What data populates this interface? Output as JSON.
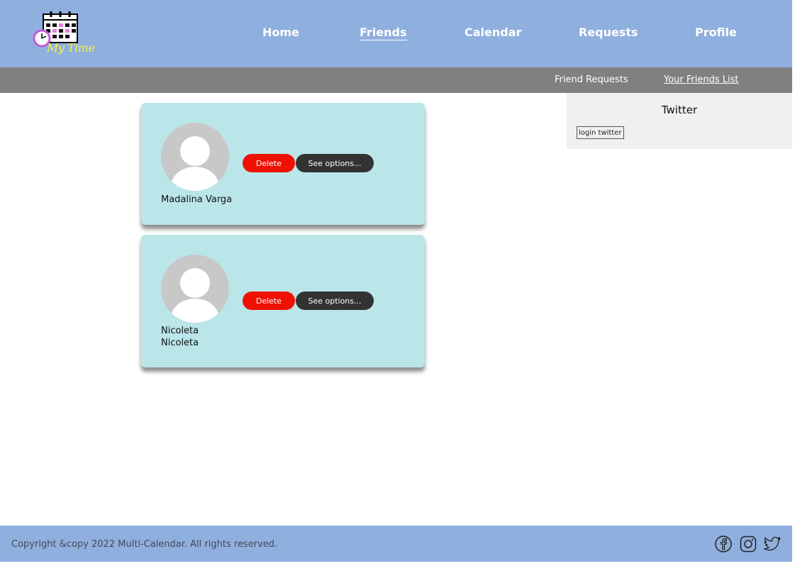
{
  "header": {
    "logo_text": "My Time",
    "nav": [
      {
        "label": "Home",
        "active": false
      },
      {
        "label": "Friends",
        "active": true
      },
      {
        "label": "Calendar",
        "active": false
      },
      {
        "label": "Requests",
        "active": false
      },
      {
        "label": "Profile",
        "active": false
      }
    ]
  },
  "subnav": {
    "friend_requests": "Friend Requests",
    "friends_list": "Your Friends List"
  },
  "friends": [
    {
      "name": "Madalina Varga",
      "delete_label": "Delete",
      "options_label": "See options..."
    },
    {
      "name": "Nicoleta Nicoleta",
      "delete_label": "Delete",
      "options_label": "See options..."
    }
  ],
  "twitter": {
    "title": "Twitter",
    "login_label": "login twitter"
  },
  "footer": {
    "copyright": "Copyright &copy 2022 Multi-Calendar. All rights reserved.",
    "social_icons": [
      "facebook-icon",
      "instagram-icon",
      "twitter-icon"
    ]
  },
  "colors": {
    "header_bg": "#8fafde",
    "subnav_bg": "#808080",
    "card_bg": "#bae6e9",
    "delete_btn": "#ee1104",
    "options_btn": "#333333",
    "logo_text": "#f7f34a"
  }
}
